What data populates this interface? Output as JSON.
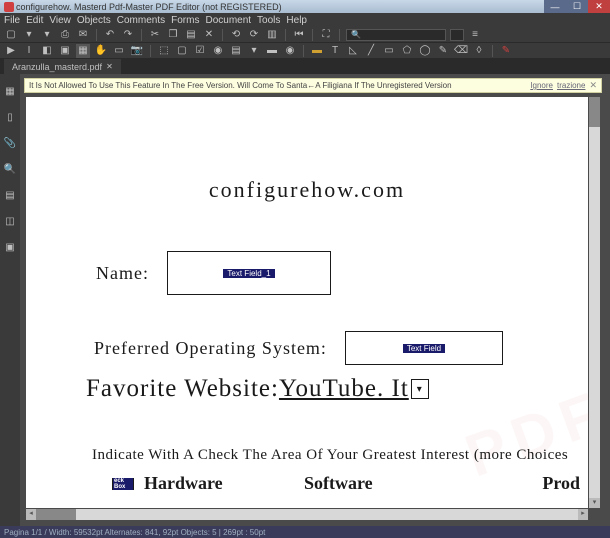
{
  "window": {
    "title": "configurehow. Masterd Pdf-Master PDF Editor (not REGISTERED)"
  },
  "menu": [
    "File",
    "Edit",
    "View",
    "Objects",
    "Comments",
    "Forms",
    "Document",
    "Tools",
    "Help"
  ],
  "tab": {
    "name": "Aranzulla_masterd.pdf",
    "close": "✕"
  },
  "notice": {
    "text": "It Is Not Allowed To Use This Feature In The Free Version. Will Come To Santa←A Filigiana If The Unregistered Version",
    "action1": "Ignore",
    "action2": "trazione",
    "close": "✕"
  },
  "document": {
    "site_title": "configurehow.com",
    "name_label": "Name:",
    "name_field_badge": "Text Field_1",
    "os_label": "Preferred Operating System:",
    "os_field_badge": "Text Field",
    "fav_label_a": "Favorite Website:",
    "fav_label_b": " YouTube. It",
    "instruction": "Indicate With A Check The Area Of Your Greatest Interest (more Choices",
    "checkbox_badge": "eck Box",
    "col_hardware": "Hardware",
    "col_software": "Software",
    "col_prod": "Prod",
    "watermark": "PDF"
  },
  "status": "Pagina 1/1 / Width: 59532pt Alternates: 841, 92pt Objects: 5 | 269pt : 50pt"
}
